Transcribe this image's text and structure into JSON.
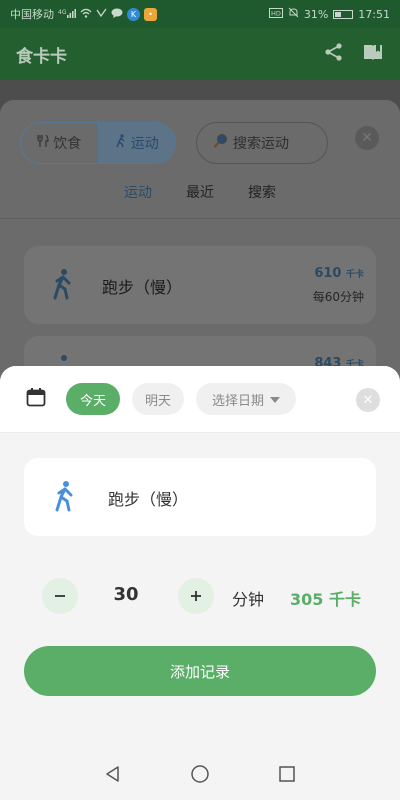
{
  "status_bar": {
    "carrier": "中国移动",
    "network": "4G",
    "battery": "31%",
    "time": "17:51"
  },
  "app_bar": {
    "title": "食卡卡",
    "actions": [
      "share-icon",
      "book-icon"
    ]
  },
  "background_sheet": {
    "segment": {
      "food_label": "饮食",
      "exercise_label": "运动",
      "selected": "运动"
    },
    "search_placeholder": "搜索运动",
    "tabs": [
      {
        "label": "运动",
        "active": true
      },
      {
        "label": "最近",
        "active": false
      },
      {
        "label": "搜索",
        "active": false
      }
    ],
    "items": [
      {
        "name": "跑步（慢）",
        "kcal": "610",
        "kcal_unit": "千卡",
        "per": "每60分钟"
      },
      {
        "kcal": "843",
        "kcal_unit": "千卡"
      }
    ]
  },
  "sheet": {
    "date_chips": [
      {
        "label": "今天",
        "selected": true
      },
      {
        "label": "明天",
        "selected": false
      },
      {
        "label": "选择日期",
        "selected": false
      }
    ],
    "exercise_name": "跑步（慢）",
    "quantity": "30",
    "unit": "分钟",
    "calories": "305 千卡",
    "add_button": "添加记录"
  },
  "colors": {
    "brand_green": "#5aae67",
    "app_bar": "#24602f",
    "accent_blue": "#4a90d9"
  }
}
